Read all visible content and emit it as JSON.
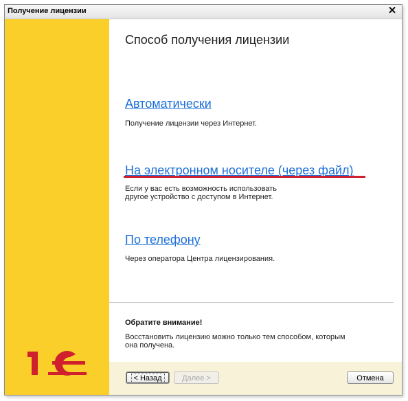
{
  "window": {
    "title": "Получение лицензии",
    "close_glyph": "✕"
  },
  "brand": {
    "logo_name": "1c-logo-icon",
    "accent_color": "#fbcf2a",
    "logo_color": "#d0202e"
  },
  "main": {
    "heading": "Способ получения лицензии",
    "options": [
      {
        "label": "Автоматически",
        "description": [
          "Получение лицензии через Интернет."
        ]
      },
      {
        "label": "На электронном носителе (через файл)",
        "description": [
          "Если у вас есть возможность использовать",
          "другое устройство с доступом в Интернет."
        ]
      },
      {
        "label": "По телефону",
        "description": [
          "Через оператора Центра лицензирования."
        ]
      }
    ],
    "note": {
      "title": "Обратите внимание!",
      "lines": [
        "Восстановить лицензию можно только тем способом, которым",
        "она получена."
      ]
    }
  },
  "footer": {
    "back_label": "< Назад",
    "next_label": "Далее >",
    "cancel_label": "Отмена"
  }
}
